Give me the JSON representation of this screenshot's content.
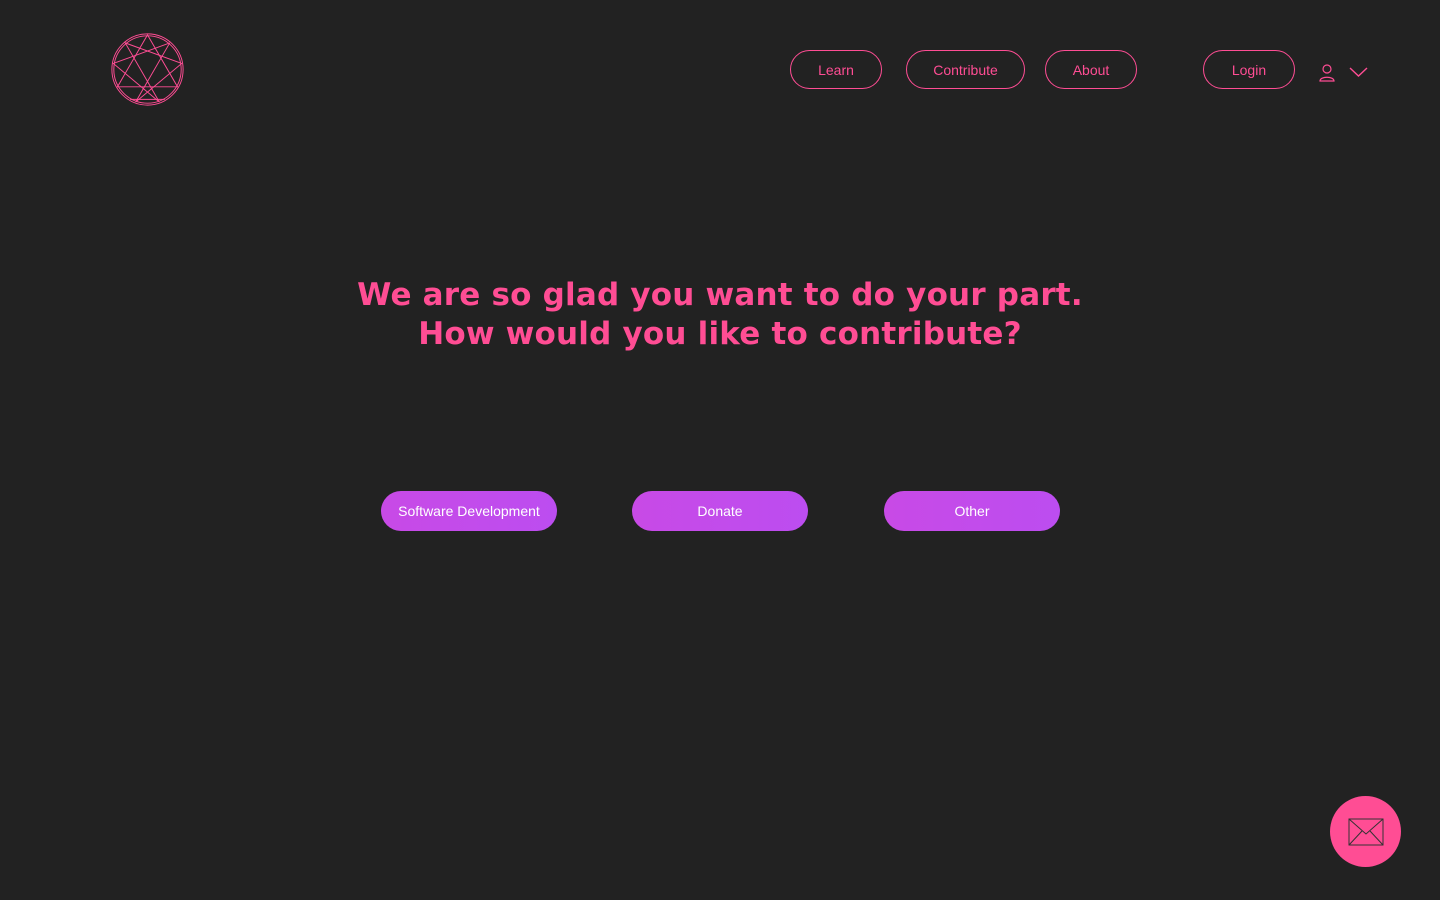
{
  "colors": {
    "background": "#222222",
    "accent": "#ff4d94",
    "button_gradient_start": "#c84ae6",
    "button_gradient_end": "#bc4df0",
    "button_text": "#ffffff"
  },
  "header": {
    "logo_icon": "enneagram-logo-icon",
    "nav": {
      "learn": "Learn",
      "contribute": "Contribute",
      "about": "About",
      "login": "Login"
    },
    "user_icon": "user-icon",
    "menu_icon": "chevron-down-icon"
  },
  "main": {
    "heading_line1": "We are so glad you want to do your part.",
    "heading_line2": "How would you like to contribute?",
    "options": {
      "software": "Software Development",
      "donate": "Donate",
      "other": "Other"
    }
  },
  "fab": {
    "icon": "envelope-icon"
  }
}
